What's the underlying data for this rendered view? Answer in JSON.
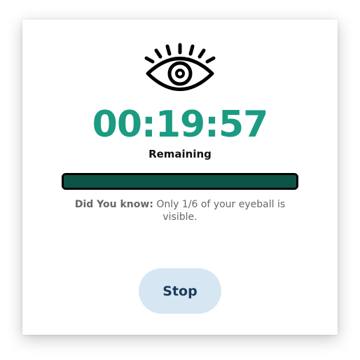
{
  "timer": {
    "value": "00:19:57",
    "caption": "Remaining"
  },
  "progress": {
    "fraction": 1.0
  },
  "fact": {
    "lead": "Did You know:",
    "text": " Only 1/6 of your eyeball is visible."
  },
  "stop_button": {
    "label": "Stop"
  },
  "icons": {
    "eye": "eye-icon"
  },
  "colors": {
    "timer": "#1a9b82",
    "progress_fill": "#0d5346",
    "button_bg": "#d6e6f2",
    "button_text": "#1c3a5c"
  }
}
